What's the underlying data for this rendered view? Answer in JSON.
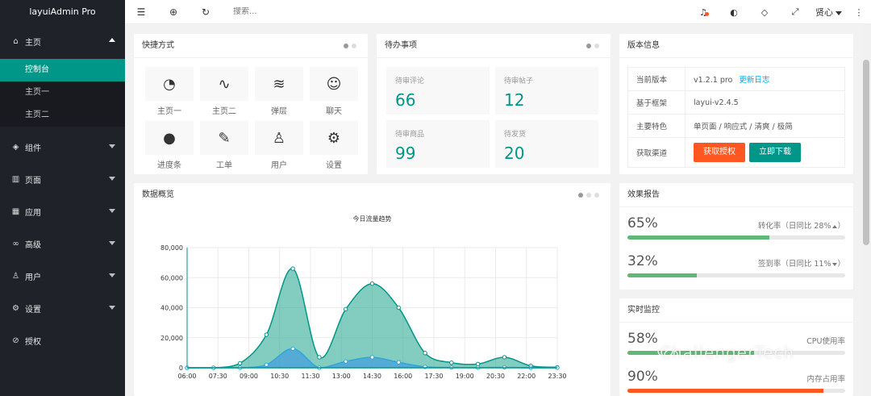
{
  "app": {
    "title": "layuiAdmin Pro"
  },
  "sidebar": {
    "groups": [
      {
        "label": "主页",
        "icon": "home-icon",
        "expanded": true,
        "items": [
          "控制台",
          "主页一",
          "主页二"
        ],
        "active_item": "控制台"
      },
      {
        "label": "组件",
        "icon": "cube-icon"
      },
      {
        "label": "页面",
        "icon": "page-icon"
      },
      {
        "label": "应用",
        "icon": "app-icon"
      },
      {
        "label": "高级",
        "icon": "senior-icon"
      },
      {
        "label": "用户",
        "icon": "user-icon"
      },
      {
        "label": "设置",
        "icon": "gear-icon"
      },
      {
        "label": "授权",
        "icon": "auth-icon"
      }
    ]
  },
  "header": {
    "search_placeholder": "搜索...",
    "user_name": "贤心",
    "icons": [
      "menu-toggle-icon",
      "globe-icon",
      "refresh-icon",
      "bell-icon",
      "theme-icon",
      "note-icon",
      "fullscreen-icon",
      "more-icon"
    ]
  },
  "quick": {
    "title": "快捷方式",
    "items": [
      {
        "label": "主页一",
        "icon": "gauge-icon"
      },
      {
        "label": "主页二",
        "icon": "pulse-icon"
      },
      {
        "label": "弹层",
        "icon": "layers-icon"
      },
      {
        "label": "聊天",
        "icon": "chat-icon"
      },
      {
        "label": "进度条",
        "icon": "compass-icon"
      },
      {
        "label": "工单",
        "icon": "form-icon"
      },
      {
        "label": "用户",
        "icon": "user-icon"
      },
      {
        "label": "设置",
        "icon": "gear-icon"
      }
    ]
  },
  "todo": {
    "title": "待办事项",
    "items": [
      {
        "label": "待审评论",
        "value": "66"
      },
      {
        "label": "待审帖子",
        "value": "12"
      },
      {
        "label": "待审商品",
        "value": "99"
      },
      {
        "label": "待发货",
        "value": "20"
      }
    ]
  },
  "version": {
    "title": "版本信息",
    "rows": [
      {
        "key": "当前版本",
        "value": "v1.2.1 pro",
        "link": "更新日志"
      },
      {
        "key": "基于框架",
        "value": "layui-v2.4.5"
      },
      {
        "key": "主要特色",
        "value": "单页面 / 响应式 / 清爽 / 极简"
      },
      {
        "key": "获取渠道",
        "btn1": "获取授权",
        "btn2": "立即下载"
      }
    ]
  },
  "effect": {
    "title": "效果报告",
    "rows": [
      {
        "value": "65%",
        "desc": "转化率（日同比 28%",
        "trend": "up",
        "fill": 0.65
      },
      {
        "value": "32%",
        "desc": "签到率（日同比 11%",
        "trend": "down",
        "fill": 0.32
      }
    ]
  },
  "monitor": {
    "title": "实时监控",
    "rows": [
      {
        "value": "58%",
        "desc": "CPU使用率",
        "fill": 0.58,
        "color": "#5fb878"
      },
      {
        "value": "90%",
        "desc": "内存占用率",
        "fill": 0.9,
        "color": "#ff5722"
      }
    ]
  },
  "overview": {
    "title": "数据概览"
  },
  "chart_data": {
    "type": "area",
    "title": "今日流量趋势",
    "x": [
      "06:00",
      "07:30",
      "09:00",
      "10:30",
      "11:30",
      "13:00",
      "14:30",
      "16:00",
      "17:30",
      "19:00",
      "20:30",
      "22:00",
      "23:30"
    ],
    "ylim": [
      0,
      80000
    ],
    "yticks": [
      "0",
      "20,000",
      "40,000",
      "60,000",
      "80,000"
    ],
    "grid": true,
    "series": [
      {
        "values": [
          0,
          0,
          3000,
          22000,
          66000,
          7000,
          39000,
          56000,
          40000,
          9800,
          3400,
          2500,
          7000,
          1300,
          300
        ]
      },
      {
        "values": [
          0,
          0,
          0,
          2000,
          12700,
          0,
          4200,
          7000,
          3600,
          600,
          200,
          100,
          300,
          0,
          0
        ]
      }
    ],
    "colors": {
      "series1": "#2ec7c9",
      "series2": "#5ab1ef",
      "line": "#009688"
    }
  },
  "watermark": "ChallengerTech"
}
